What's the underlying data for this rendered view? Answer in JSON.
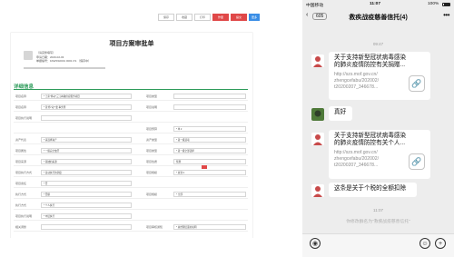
{
  "web_form": {
    "toolbar": [
      "保存",
      "收藏",
      "打印",
      "作废",
      "提交",
      "更多"
    ],
    "title": "项目方案审批单",
    "applicant": {
      "name": "（请完整填写）",
      "lines": [
        "申请日期：2020-02-03",
        "单据编号：FAWSS0001 0001 FS （保存中）"
      ]
    },
    "section_title": "详细信息",
    "rows": [
      {
        "l1": "项目名称",
        "v1": "* 王家\"移动\"三江两路供应服务项目",
        "l2": "项目类型",
        "v2": ""
      },
      {
        "l1": "项目名称",
        "v1": "* 某\"移\"动\"\"委 事务所",
        "l2": "项目说明",
        "v2": ""
      },
      {
        "l1": "项目执行说明",
        "v1": "",
        "l2": "",
        "v2": ""
      },
      {
        "l1": "",
        "v1": "",
        "l2": "项目预算",
        "v2": "* 单 ▾"
      },
      {
        "l1": "资产代表",
        "v1": "* 请选择资产",
        "l2": "资产类型",
        "v2": "* 第一级选项"
      },
      {
        "l1": "项目属性",
        "v1": "* 一级完全放开",
        "l2": "项目类型",
        "v2": "* 第一级全部选择"
      },
      {
        "l1": "项目来源",
        "v1": "* 基础的来源",
        "l2": "项目性质",
        "v2": "预算"
      },
      {
        "l1": "项目执行方式",
        "v1": "* 自动执行的调度",
        "l2": "项目规模",
        "v2": "* 总到 ▾"
      },
      {
        "l1": "项目责任",
        "v1": "* 否",
        "l2": "",
        "v2": ""
      },
      {
        "l1": "执行方式",
        "v1": "* 否额",
        "l2": "项目规模",
        "v2": "* 全部"
      },
      {
        "l1": "执行方式",
        "v1": "* 个人执行",
        "l2": "",
        "v2": ""
      },
      {
        "l1": "项目执行说明",
        "v1": "* 中层执行",
        "l2": "",
        "v2": ""
      },
      {
        "l1": "相关调整",
        "v1": "",
        "l2": "项目审核通知",
        "v2": "* 总经理层面的说明"
      }
    ]
  },
  "chat": {
    "status": {
      "carrier": "中国移动",
      "time": "11:07",
      "battery": "100%"
    },
    "back_count": "605",
    "title": "救疾战疫慈善信托(4)",
    "more": "•••",
    "messages": [
      {
        "type": "time",
        "text": "09:47"
      },
      {
        "type": "link",
        "lines": [
          "关于支持新型冠状病毒感染",
          "的肺炎疫情防控有关捐赠..."
        ],
        "url": [
          "http://szs.mof.gov.cn/",
          "zhengcefabu/202002/",
          "t20200207_346678..."
        ]
      },
      {
        "type": "text",
        "text": "真好"
      },
      {
        "type": "link",
        "lines": [
          "关于支持新型冠状病毒感染",
          "的肺炎疫情防控有关个人..."
        ],
        "url": [
          "http://szs.mof.gov.cn/",
          "zhengcefabu/202002/",
          "t20200207_346678..."
        ]
      },
      {
        "type": "text",
        "text": "这条是关于个税的全额扣除"
      },
      {
        "type": "time",
        "text": "11:07"
      },
      {
        "type": "system",
        "text": "你修改群名为\"救疾战疫慈善信托\""
      }
    ],
    "link_icon": "link-icon",
    "voice_icon": "voice-icon",
    "emoji_icon": "emoji-icon",
    "plus_icon": "plus-icon"
  }
}
